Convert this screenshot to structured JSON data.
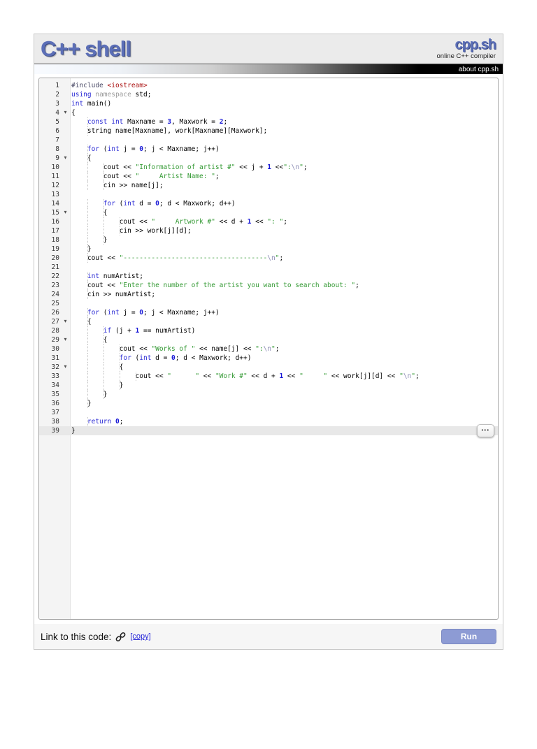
{
  "header": {
    "logo": "C++ shell",
    "brand": "cpp.sh",
    "brand_sub": "online C++ compiler",
    "about_link": "about cpp.sh"
  },
  "footer": {
    "link_label": "Link to this code:",
    "copy_link": "[copy]",
    "run_label": "Run"
  },
  "colors": {
    "accent_blue": "#5c6fb7",
    "keyword": "#2a2ad4",
    "number": "#1515d6",
    "string": "#339933",
    "escape": "#8c8cb4",
    "include_path": "#aa1111",
    "run_button": "#8d9bd4",
    "active_line_bg": "#e8e8e8"
  },
  "editor": {
    "active_line": 39,
    "fold_lines": [
      4,
      9,
      15,
      27,
      29,
      32
    ],
    "overflow_button": "•••",
    "fold_icon": "▾",
    "lines": [
      {
        "tokens": [
          [
            "m",
            "#include"
          ],
          [
            "p",
            " "
          ],
          [
            "l",
            "<iostream>"
          ]
        ]
      },
      {
        "tokens": [
          [
            "k",
            "using"
          ],
          [
            "p",
            " "
          ],
          [
            "ns",
            "namespace"
          ],
          [
            "p",
            " std;"
          ]
        ]
      },
      {
        "tokens": [
          [
            "k",
            "int"
          ],
          [
            "p",
            " main()"
          ]
        ]
      },
      {
        "tokens": [
          [
            "p",
            "{"
          ]
        ]
      },
      {
        "tokens": [
          [
            "p",
            "    "
          ],
          [
            "k",
            "const"
          ],
          [
            "p",
            " "
          ],
          [
            "k",
            "int"
          ],
          [
            "p",
            " Maxname = "
          ],
          [
            "n",
            "3"
          ],
          [
            "p",
            ", Maxwork = "
          ],
          [
            "n",
            "2"
          ],
          [
            "p",
            ";"
          ]
        ]
      },
      {
        "tokens": [
          [
            "p",
            "    string name[Maxname], work[Maxname][Maxwork];"
          ]
        ]
      },
      {
        "tokens": []
      },
      {
        "tokens": [
          [
            "p",
            "    "
          ],
          [
            "k",
            "for"
          ],
          [
            "p",
            " ("
          ],
          [
            "k",
            "int"
          ],
          [
            "p",
            " j = "
          ],
          [
            "n",
            "0"
          ],
          [
            "p",
            "; j < Maxname; j++)"
          ]
        ]
      },
      {
        "tokens": [
          [
            "p",
            "    {"
          ]
        ]
      },
      {
        "tokens": [
          [
            "p",
            "        cout << "
          ],
          [
            "s",
            "\"Information of artist #\""
          ],
          [
            "p",
            " << j + "
          ],
          [
            "n",
            "1"
          ],
          [
            "p",
            " <<"
          ],
          [
            "s",
            "\":"
          ],
          [
            "e",
            "\\n"
          ],
          [
            "s",
            "\""
          ],
          [
            "p",
            ";"
          ]
        ]
      },
      {
        "tokens": [
          [
            "p",
            "        cout << "
          ],
          [
            "s",
            "\"     Artist Name: \""
          ],
          [
            "p",
            ";"
          ]
        ]
      },
      {
        "tokens": [
          [
            "p",
            "        cin >> name[j];"
          ]
        ]
      },
      {
        "tokens": []
      },
      {
        "tokens": [
          [
            "p",
            "        "
          ],
          [
            "k",
            "for"
          ],
          [
            "p",
            " ("
          ],
          [
            "k",
            "int"
          ],
          [
            "p",
            " d = "
          ],
          [
            "n",
            "0"
          ],
          [
            "p",
            "; d < Maxwork; d++)"
          ]
        ]
      },
      {
        "tokens": [
          [
            "p",
            "        {"
          ]
        ]
      },
      {
        "tokens": [
          [
            "p",
            "            cout << "
          ],
          [
            "s",
            "\"     Artwork #\""
          ],
          [
            "p",
            " << d + "
          ],
          [
            "n",
            "1"
          ],
          [
            "p",
            " << "
          ],
          [
            "s",
            "\": \""
          ],
          [
            "p",
            ";"
          ]
        ]
      },
      {
        "tokens": [
          [
            "p",
            "            cin >> work[j][d];"
          ]
        ]
      },
      {
        "tokens": [
          [
            "p",
            "        }"
          ]
        ]
      },
      {
        "tokens": [
          [
            "p",
            "    }"
          ]
        ]
      },
      {
        "tokens": [
          [
            "p",
            "    cout << "
          ],
          [
            "s",
            "\"------------------------------------"
          ],
          [
            "e",
            "\\n"
          ],
          [
            "s",
            "\""
          ],
          [
            "p",
            ";"
          ]
        ]
      },
      {
        "tokens": []
      },
      {
        "tokens": [
          [
            "p",
            "    "
          ],
          [
            "k",
            "int"
          ],
          [
            "p",
            " numArtist;"
          ]
        ]
      },
      {
        "tokens": [
          [
            "p",
            "    cout << "
          ],
          [
            "s",
            "\"Enter the number of the artist you want to search about: \""
          ],
          [
            "p",
            ";"
          ]
        ]
      },
      {
        "tokens": [
          [
            "p",
            "    cin >> numArtist;"
          ]
        ]
      },
      {
        "tokens": []
      },
      {
        "tokens": [
          [
            "p",
            "    "
          ],
          [
            "k",
            "for"
          ],
          [
            "p",
            " ("
          ],
          [
            "k",
            "int"
          ],
          [
            "p",
            " j = "
          ],
          [
            "n",
            "0"
          ],
          [
            "p",
            "; j < Maxname; j++)"
          ]
        ]
      },
      {
        "tokens": [
          [
            "p",
            "    {"
          ]
        ]
      },
      {
        "tokens": [
          [
            "p",
            "        "
          ],
          [
            "k",
            "if"
          ],
          [
            "p",
            " (j + "
          ],
          [
            "n",
            "1"
          ],
          [
            "p",
            " == numArtist)"
          ]
        ]
      },
      {
        "tokens": [
          [
            "p",
            "        {"
          ]
        ]
      },
      {
        "tokens": [
          [
            "p",
            "            cout << "
          ],
          [
            "s",
            "\"Works of \""
          ],
          [
            "p",
            " << name[j] << "
          ],
          [
            "s",
            "\":"
          ],
          [
            "e",
            "\\n"
          ],
          [
            "s",
            "\""
          ],
          [
            "p",
            ";"
          ]
        ]
      },
      {
        "tokens": [
          [
            "p",
            "            "
          ],
          [
            "k",
            "for"
          ],
          [
            "p",
            " ("
          ],
          [
            "k",
            "int"
          ],
          [
            "p",
            " d = "
          ],
          [
            "n",
            "0"
          ],
          [
            "p",
            "; d < Maxwork; d++)"
          ]
        ]
      },
      {
        "tokens": [
          [
            "p",
            "            {"
          ]
        ]
      },
      {
        "tokens": [
          [
            "p",
            "                cout << "
          ],
          [
            "s",
            "\"      \""
          ],
          [
            "p",
            " << "
          ],
          [
            "s",
            "\"Work #\""
          ],
          [
            "p",
            " << d + "
          ],
          [
            "n",
            "1"
          ],
          [
            "p",
            " << "
          ],
          [
            "s",
            "\"     \""
          ],
          [
            "p",
            " << work[j][d] << "
          ],
          [
            "s",
            "\""
          ],
          [
            "e",
            "\\n"
          ],
          [
            "s",
            "\""
          ],
          [
            "p",
            ";"
          ]
        ]
      },
      {
        "tokens": [
          [
            "p",
            "            }"
          ]
        ]
      },
      {
        "tokens": [
          [
            "p",
            "        }"
          ]
        ]
      },
      {
        "tokens": [
          [
            "p",
            "    }"
          ]
        ]
      },
      {
        "tokens": []
      },
      {
        "tokens": [
          [
            "p",
            "    "
          ],
          [
            "k",
            "return"
          ],
          [
            "p",
            " "
          ],
          [
            "n",
            "0"
          ],
          [
            "p",
            ";"
          ]
        ]
      },
      {
        "tokens": [
          [
            "p",
            "}"
          ]
        ]
      }
    ]
  }
}
